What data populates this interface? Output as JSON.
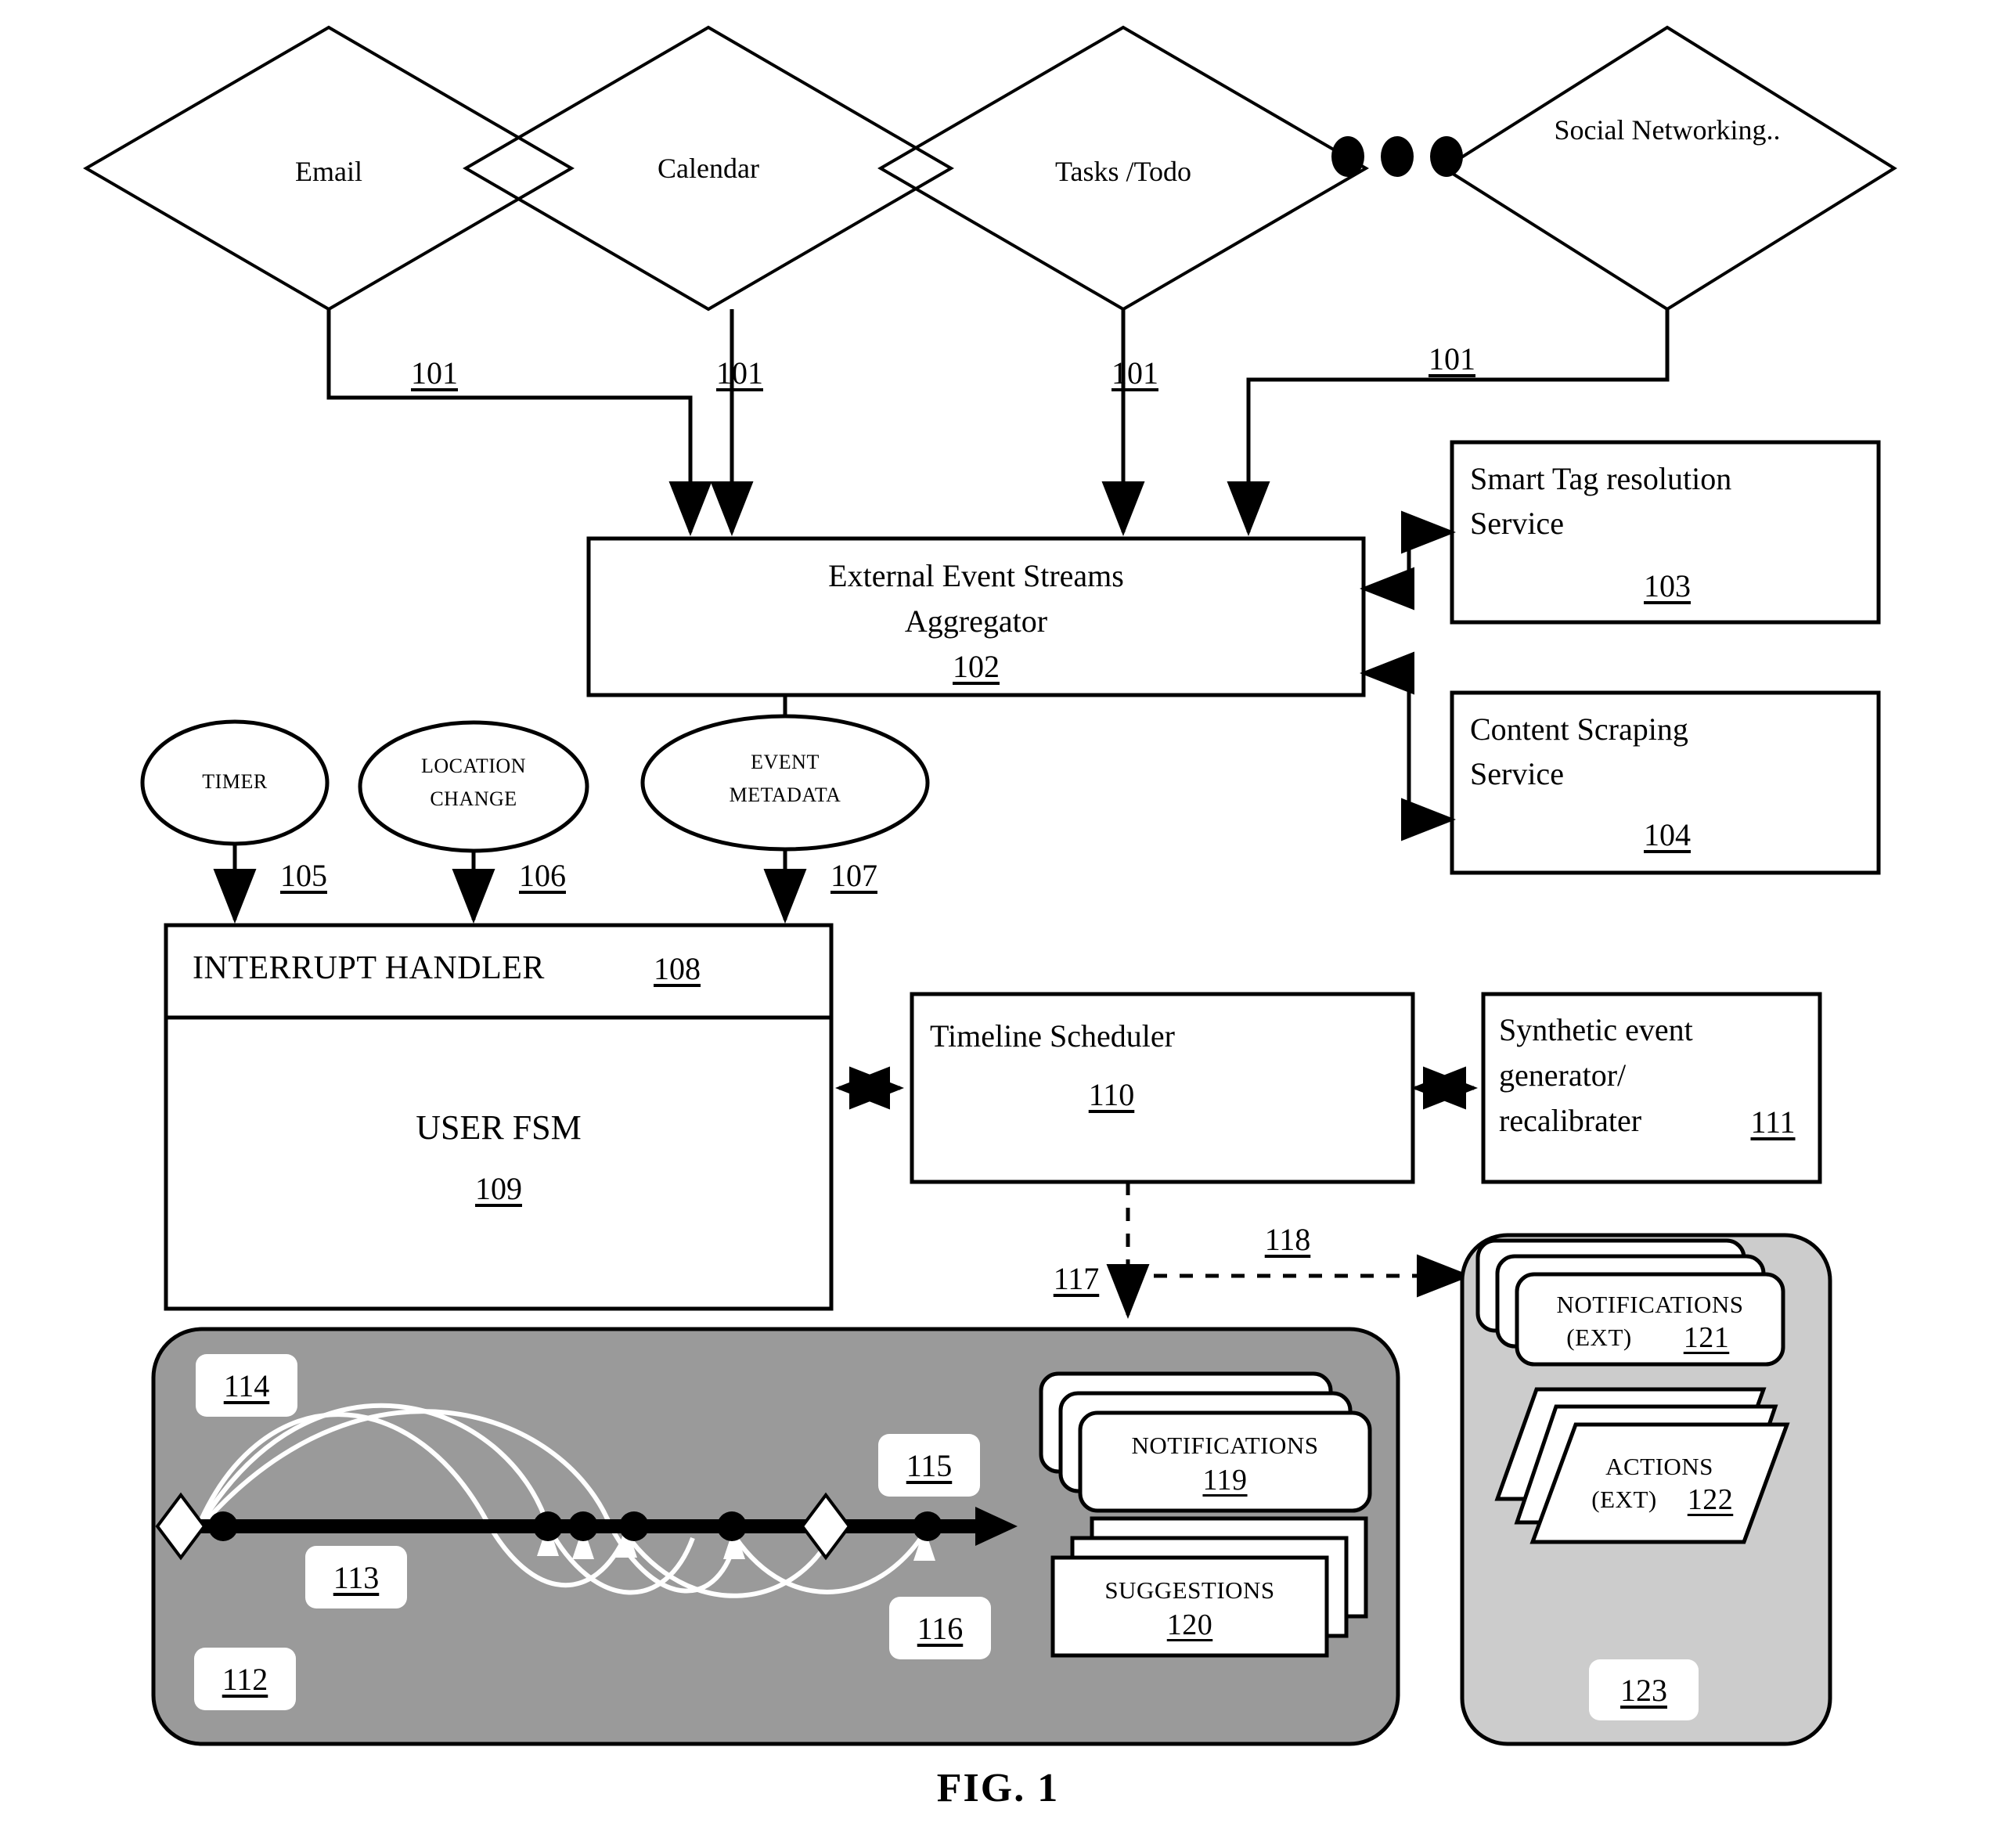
{
  "figure": {
    "caption": "FIG. 1"
  },
  "sources": {
    "items": [
      {
        "label": "Email",
        "ref": "101"
      },
      {
        "label": "Calendar",
        "ref": "101"
      },
      {
        "label": "Tasks /Todo",
        "ref": "101"
      },
      {
        "label": "Social Networking..",
        "ref": "101"
      }
    ],
    "ellipsis": "•  •  •"
  },
  "aggregator": {
    "line1": "External Event Streams",
    "line2": "Aggregator",
    "ref": "102"
  },
  "services": [
    {
      "line1": "Smart Tag resolution",
      "line2": "Service",
      "ref": "103"
    },
    {
      "line1": "Content Scraping",
      "line2": "Service",
      "ref": "104"
    }
  ],
  "triggers": [
    {
      "line1": "TIMER",
      "line2": "",
      "ref": "105"
    },
    {
      "line1": "LOCATION",
      "line2": "CHANGE",
      "ref": "106"
    },
    {
      "line1": "EVENT",
      "line2": "METADATA",
      "ref": "107"
    }
  ],
  "interrupt_handler": {
    "label": "INTERRUPT HANDLER",
    "ref": "108"
  },
  "user_fsm": {
    "label": "USER FSM",
    "ref": "109"
  },
  "timeline_scheduler": {
    "label": "Timeline Scheduler",
    "ref": "110"
  },
  "synthetic_generator": {
    "line1": "Synthetic event",
    "line2": "generator/",
    "line3": "recalibrater",
    "ref": "111"
  },
  "flow_refs": {
    "to_timeline": "117",
    "to_external": "118"
  },
  "timeline_panel": {
    "ref_panel": "112",
    "ref_axis": "113",
    "ref_start": "114",
    "ref_marker": "115",
    "ref_arcs": "116",
    "fill": "#9a9a9a"
  },
  "internal_cards": [
    {
      "label": "NOTIFICATIONS",
      "ref": "119"
    },
    {
      "label": "SUGGESTIONS",
      "ref": "120"
    }
  ],
  "external_panel": {
    "ref": "123",
    "fill": "#cccccc",
    "cards": [
      {
        "line1": "NOTIFICATIONS",
        "line2": "(EXT)",
        "ref": "121"
      },
      {
        "line1": "ACTIONS",
        "line2": "(EXT)",
        "ref": "122"
      }
    ]
  }
}
